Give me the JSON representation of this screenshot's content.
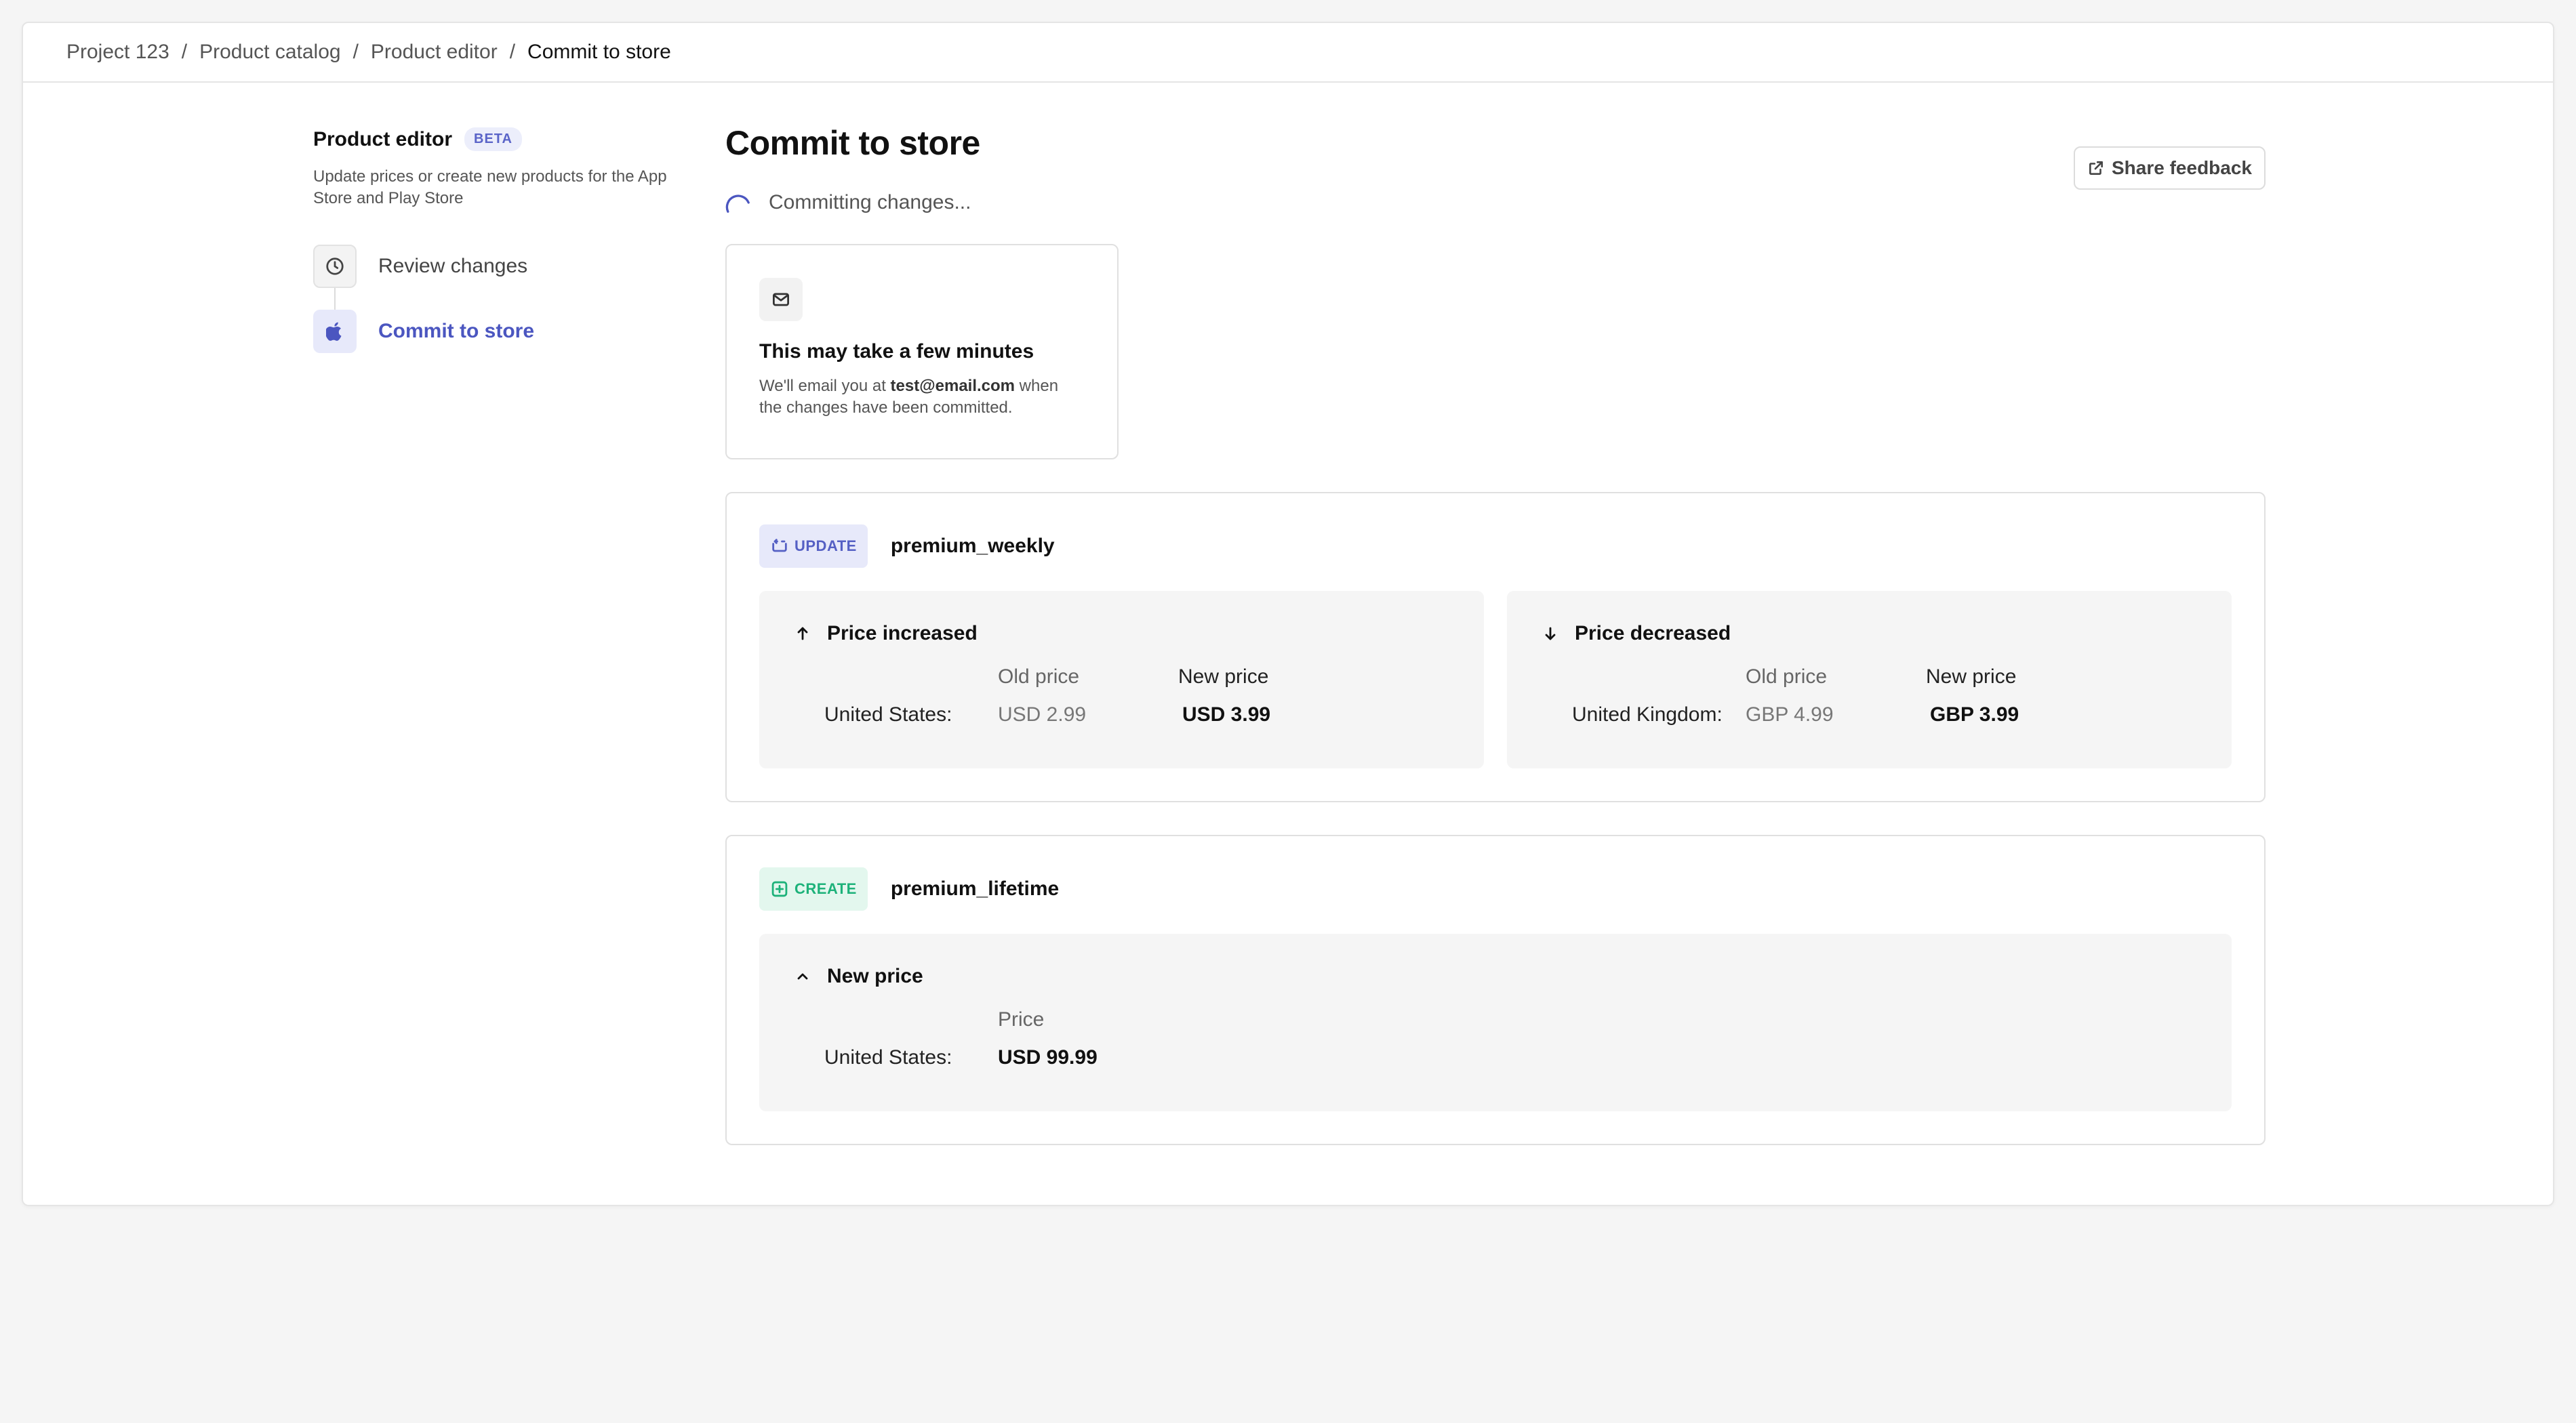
{
  "breadcrumb": {
    "items": [
      "Project 123",
      "Product catalog",
      "Product editor"
    ],
    "separator": "/",
    "current": "Commit to store"
  },
  "sidebar": {
    "title": "Product editor",
    "badge": "BETA",
    "description": "Update prices or create new products for the App Store and Play Store",
    "steps": [
      {
        "label": "Review changes",
        "icon": "clock-icon",
        "active": false
      },
      {
        "label": "Commit to store",
        "icon": "apple-icon",
        "active": true
      }
    ]
  },
  "main": {
    "title": "Commit to store",
    "feedback_label": "Share feedback",
    "status_text": "Committing changes...",
    "notice": {
      "title": "This may take a few minutes",
      "body_prefix": "We'll email you at ",
      "email": "test@email.com",
      "body_suffix": " when the changes have been committed."
    },
    "changes": [
      {
        "tag": "UPDATE",
        "product": "premium_weekly",
        "panels": [
          {
            "heading": "Price increased",
            "icon": "arrow-up-icon",
            "old_label": "Old price",
            "new_label": "New price",
            "region": "United States:",
            "old_value": "USD 2.99",
            "new_value": "USD 3.99"
          },
          {
            "heading": "Price decreased",
            "icon": "arrow-down-icon",
            "old_label": "Old price",
            "new_label": "New price",
            "region": "United Kingdom:",
            "old_value": "GBP 4.99",
            "new_value": "GBP 3.99"
          }
        ]
      },
      {
        "tag": "CREATE",
        "product": "premium_lifetime",
        "panel": {
          "heading": "New price",
          "icon": "chevron-up-icon",
          "price_label": "Price",
          "region": "United States:",
          "value": "USD 99.99"
        }
      }
    ]
  },
  "colors": {
    "accent": "#4b56c0",
    "create": "#1db27a",
    "border": "#e0e0e0",
    "panel_bg": "#f5f5f5"
  }
}
